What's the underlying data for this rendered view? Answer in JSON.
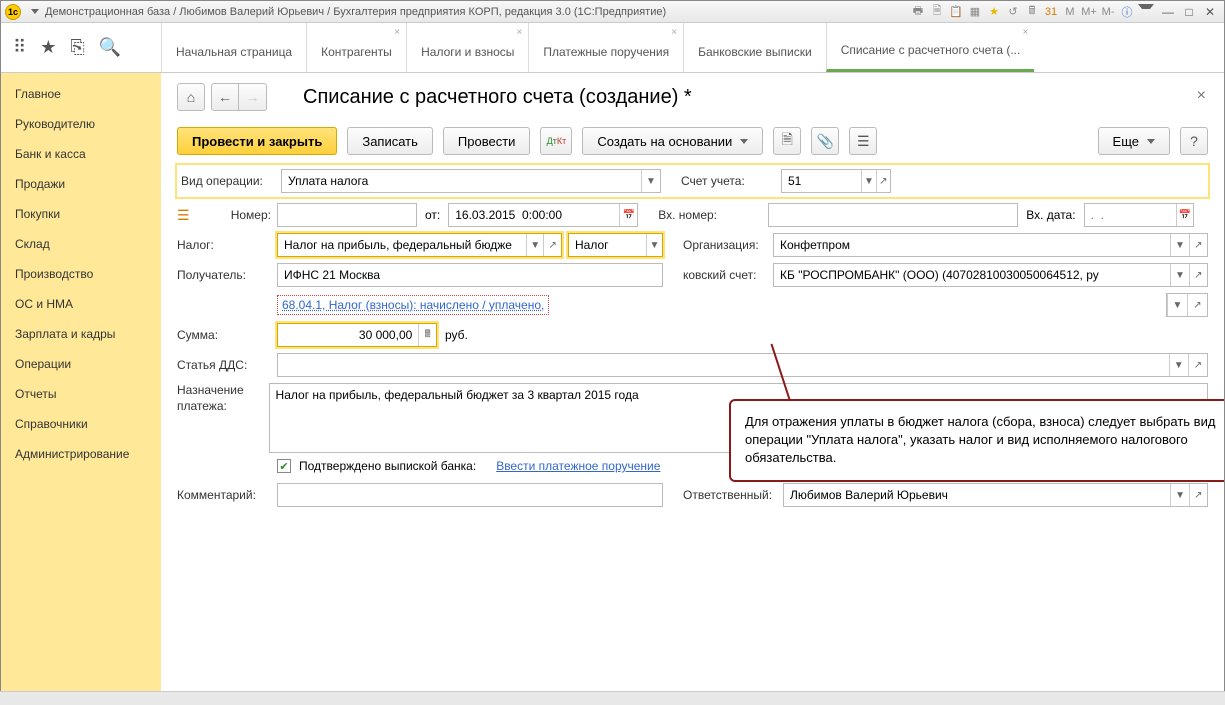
{
  "titlebar": {
    "text": "Демонстрационная база / Любимов Валерий Юрьевич / Бухгалтерия предприятия КОРП, редакция 3.0  (1С:Предприятие)",
    "m1": "M",
    "m2": "M+",
    "m3": "M-"
  },
  "tabs": [
    {
      "label": "Начальная страница",
      "closable": false
    },
    {
      "label": "Контрагенты",
      "closable": true
    },
    {
      "label": "Налоги и взносы",
      "closable": true
    },
    {
      "label": "Платежные поручения",
      "closable": true
    },
    {
      "label": "Банковские выписки",
      "closable": false
    },
    {
      "label": "Списание с расчетного счета (...",
      "closable": true,
      "active": true
    }
  ],
  "sidebar": {
    "items": [
      "Главное",
      "Руководителю",
      "Банк и касса",
      "Продажи",
      "Покупки",
      "Склад",
      "Производство",
      "ОС и НМА",
      "Зарплата и кадры",
      "Операции",
      "Отчеты",
      "Справочники",
      "Администрирование"
    ]
  },
  "page": {
    "title": "Списание с расчетного счета (создание) *"
  },
  "toolbar": {
    "primary": "Провести и закрыть",
    "save": "Записать",
    "post": "Провести",
    "create_based": "Создать на основании",
    "more": "Еще",
    "help": "?"
  },
  "form": {
    "op_type_label": "Вид операции:",
    "op_type_value": "Уплата налога",
    "account_label": "Счет учета:",
    "account_value": "51",
    "number_label": "Номер:",
    "number_value": "",
    "date_label": "от:",
    "date_value": "16.03.2015  0:00:00",
    "ext_number_label": "Вх. номер:",
    "ext_number_value": "",
    "ext_date_label": "Вх. дата:",
    "ext_date_placeholder": ".  .",
    "tax_label": "Налог:",
    "tax_value": "Налог на прибыль, федеральный бюдже",
    "tax_kind": "Налог",
    "org_label": "Организация:",
    "org_value": "Конфетпром",
    "recipient_label": "Получатель:",
    "recipient_value": "ИФНС 21 Москва",
    "bank_acc_label": "ковский счет:",
    "bank_acc_value": "КБ \"РОСПРОМБАНК\" (ООО) (40702810030050064512, ру",
    "debt_link": "68.04.1, Налог (взносы): начислено / уплачено,",
    "sum_label": "Сумма:",
    "sum_value": "30 000,00",
    "currency": "руб.",
    "dds_label": "Статья ДДС:",
    "dds_value": "",
    "purpose_label": "Назначение платежа:",
    "purpose_value": "Налог на прибыль, федеральный бюджет за 3 квартал 2015 года",
    "confirmed_label": "Подтверждено выпиской банка:",
    "enter_po": "Ввести платежное поручение",
    "comment_label": "Комментарий:",
    "comment_value": "",
    "responsible_label": "Ответственный:",
    "responsible_value": "Любимов Валерий Юрьевич"
  },
  "callout": {
    "text": "Для отражения уплаты в бюджет налога (сбора, взноса) следует выбрать вид операции \"Уплата налога\", указать налог и вид исполняемого налогового обязательства."
  }
}
